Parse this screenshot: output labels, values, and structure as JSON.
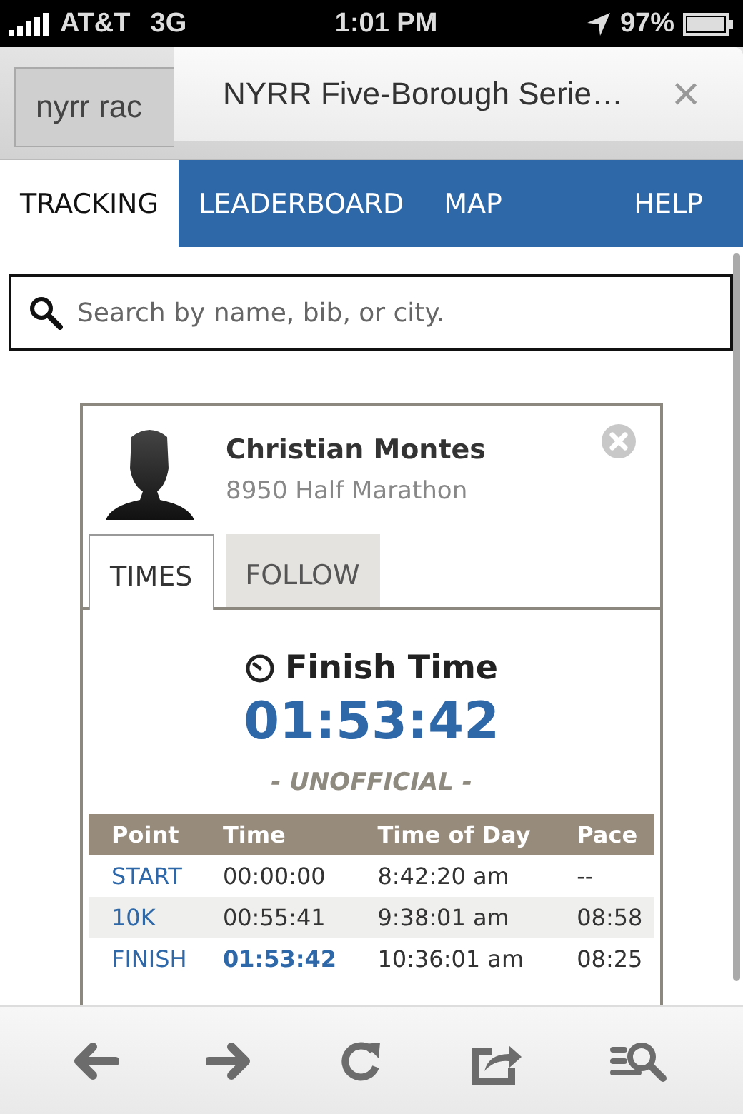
{
  "status_bar": {
    "carrier": "AT&T",
    "network": "3G",
    "time": "1:01 PM",
    "battery": "97%"
  },
  "browser_tabs": [
    {
      "title": "nyrr rac",
      "selected": false
    },
    {
      "title": "NYRR Five-Borough Serie…",
      "selected": true
    }
  ],
  "close_glyph": "×",
  "nav": [
    {
      "label": "TRACKING",
      "selected": true
    },
    {
      "label": "LEADERBOARD",
      "selected": false
    },
    {
      "label": "MAP",
      "selected": false
    },
    {
      "label": "HELP",
      "selected": false
    }
  ],
  "search": {
    "placeholder": "Search by name, bib, or city."
  },
  "runner": {
    "name": "Christian Montes",
    "detail": "8950 Half Marathon"
  },
  "card_tabs": [
    {
      "label": "TIMES",
      "selected": true
    },
    {
      "label": "FOLLOW",
      "selected": false
    }
  ],
  "finish": {
    "title": "Finish Time",
    "time": "01:53:42",
    "status": "- UNOFFICIAL -"
  },
  "table": {
    "columns": [
      "Point",
      "Time",
      "Time of Day",
      "Pace"
    ],
    "rows": [
      {
        "kind": "split",
        "point": "START",
        "time": "00:00:00",
        "time_of_day": "8:42:20 am",
        "pace": "--"
      },
      {
        "kind": "split",
        "point": "10K",
        "time": "00:55:41",
        "time_of_day": "9:38:01 am",
        "pace": "08:58"
      },
      {
        "kind": "finish",
        "point": "FINISH",
        "time": "01:53:42",
        "time_of_day": "10:36:01 am",
        "pace": "08:25"
      }
    ]
  }
}
